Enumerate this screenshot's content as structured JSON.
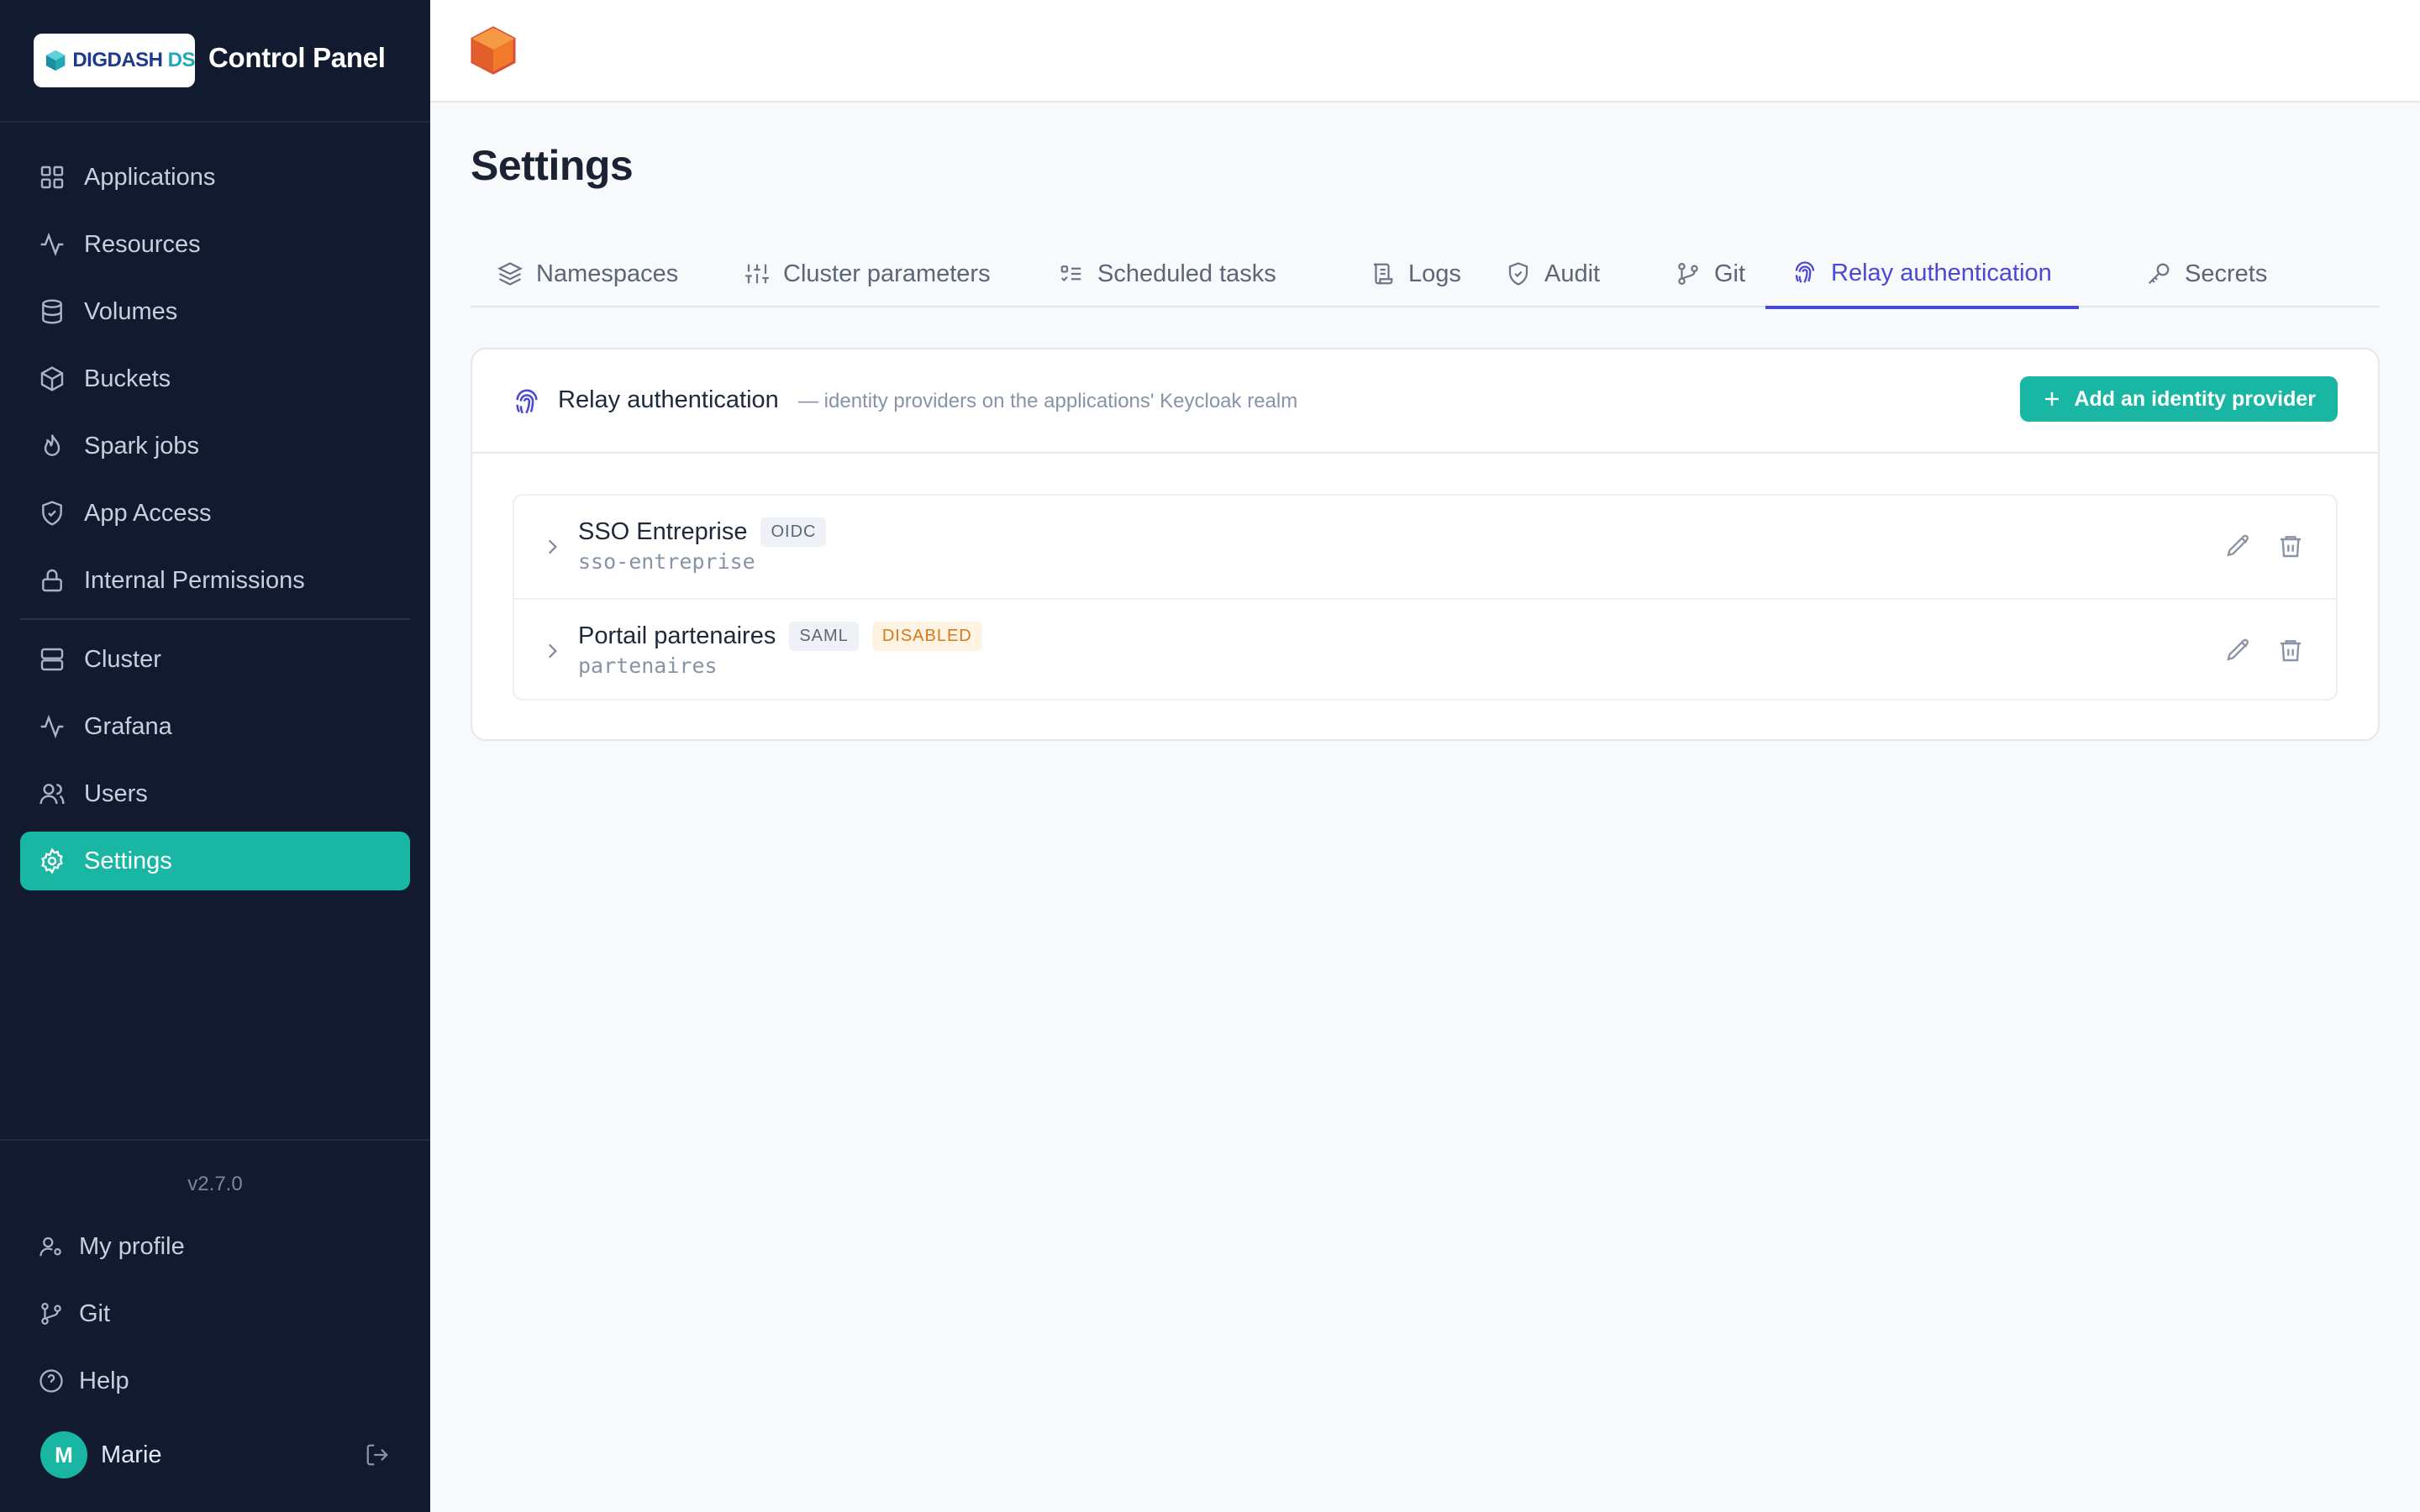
{
  "brand": {
    "logo_text_a": "DIGDASH",
    "logo_text_b": "DS",
    "title": "Control Panel"
  },
  "sidebar": {
    "items": [
      {
        "label": "Applications",
        "icon": "grid-icon",
        "active": false
      },
      {
        "label": "Resources",
        "icon": "activity-icon",
        "active": false
      },
      {
        "label": "Volumes",
        "icon": "database-icon",
        "active": false
      },
      {
        "label": "Buckets",
        "icon": "box-icon",
        "active": false
      },
      {
        "label": "Spark jobs",
        "icon": "flame-icon",
        "active": false
      },
      {
        "label": "App Access",
        "icon": "shield-icon",
        "active": false
      },
      {
        "label": "Internal Permissions",
        "icon": "lock-icon",
        "active": false
      },
      {
        "label": "Cluster",
        "icon": "server-icon",
        "active": false
      },
      {
        "label": "Grafana",
        "icon": "activity-icon",
        "active": false
      },
      {
        "label": "Users",
        "icon": "users-icon",
        "active": false
      },
      {
        "label": "Settings",
        "icon": "gear-icon",
        "active": true
      }
    ],
    "version": "v2.7.0",
    "bottom": [
      {
        "label": "My profile",
        "icon": "user-cog-icon"
      },
      {
        "label": "Git",
        "icon": "git-branch-icon"
      },
      {
        "label": "Help",
        "icon": "help-circle-icon"
      }
    ],
    "user": {
      "initial": "M",
      "name": "Marie"
    }
  },
  "page": {
    "title": "Settings"
  },
  "tabs": [
    {
      "label": "Namespaces",
      "icon": "layers-icon"
    },
    {
      "label": "Cluster parameters",
      "icon": "sliders-icon"
    },
    {
      "label": "Scheduled tasks",
      "icon": "list-todo-icon"
    },
    {
      "label": "Logs",
      "icon": "scroll-icon"
    },
    {
      "label": "Audit",
      "icon": "shield-check-icon"
    },
    {
      "label": "Git",
      "icon": "git-branch-icon"
    },
    {
      "label": "Relay authentication",
      "icon": "fingerprint-icon",
      "active": true
    },
    {
      "label": "Secrets",
      "icon": "key-icon"
    }
  ],
  "relay": {
    "title": "Relay authentication",
    "subtitle": "— identity providers on the applications' Keycloak realm",
    "add_button": "Add an identity provider",
    "providers": [
      {
        "name": "SSO Entreprise",
        "type": "OIDC",
        "status": "",
        "slug": "sso-entreprise"
      },
      {
        "name": "Portail partenaires",
        "type": "SAML",
        "status": "DISABLED",
        "slug": "partenaires"
      }
    ]
  },
  "colors": {
    "accent": "#19b7a3",
    "tab_active": "#4a48d6",
    "sidebar_bg": "#111a2e",
    "warning": "#d7791b"
  }
}
